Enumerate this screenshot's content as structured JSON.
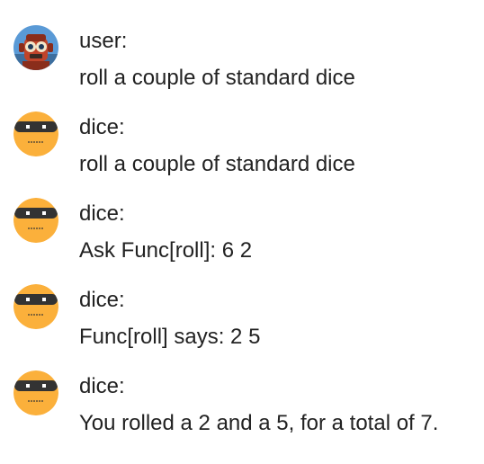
{
  "messages": [
    {
      "author": "user:",
      "text": "roll a couple of standard dice",
      "avatar_icon": "robot-avatar-icon"
    },
    {
      "author": "dice:",
      "text": "roll a couple of standard dice",
      "avatar_icon": "bot-face-icon"
    },
    {
      "author": "dice:",
      "text": "Ask Func[roll]: 6 2",
      "avatar_icon": "bot-face-icon"
    },
    {
      "author": "dice:",
      "text": "Func[roll] says: 2 5",
      "avatar_icon": "bot-face-icon"
    },
    {
      "author": "dice:",
      "text": "You rolled a 2 and a 5, for a total of 7.",
      "avatar_icon": "bot-face-icon"
    }
  ],
  "colors": {
    "bot_avatar": "#fbb03b",
    "bot_visor": "#333333",
    "user_avatar_bg": "#5a9ad6",
    "text": "#222222"
  }
}
